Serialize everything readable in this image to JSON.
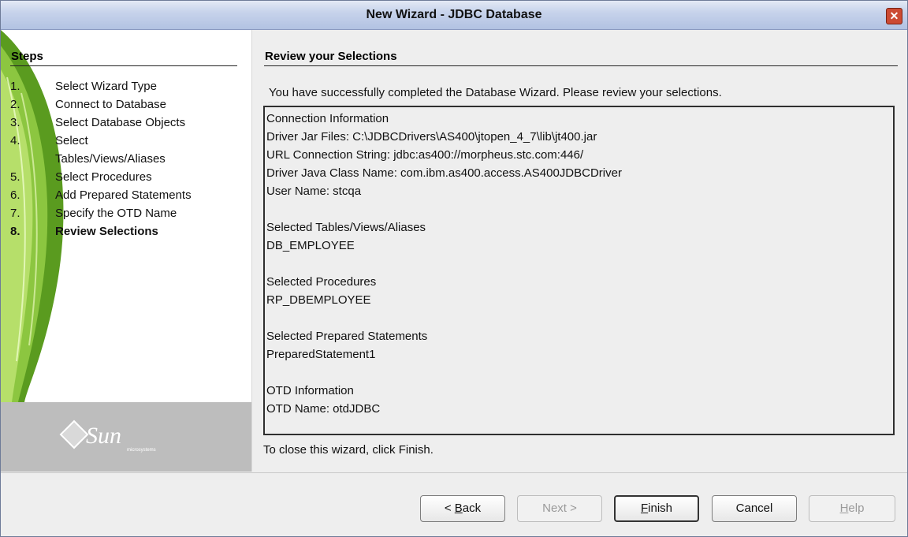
{
  "window": {
    "title": "New Wizard - JDBC Database"
  },
  "steps": {
    "heading": "Steps",
    "items": [
      {
        "num": "1.",
        "label": "Select Wizard Type"
      },
      {
        "num": "2.",
        "label": "Connect to Database"
      },
      {
        "num": "3.",
        "label": "Select Database Objects"
      },
      {
        "num": "4.",
        "label": "Select",
        "label2": "Tables/Views/Aliases"
      },
      {
        "num": "5.",
        "label": "Select Procedures"
      },
      {
        "num": "6.",
        "label": "Add Prepared Statements"
      },
      {
        "num": "7.",
        "label": "Specify the OTD Name"
      },
      {
        "num": "8.",
        "label": "Review Selections",
        "active": true
      }
    ]
  },
  "logo": {
    "text": "Sun",
    "subtext": "microsystems"
  },
  "main": {
    "heading": "Review your Selections",
    "intro": "You have successfully completed the Database Wizard.  Please review your selections.",
    "review_lines": [
      "Connection Information",
      "Driver Jar Files: C:\\JDBCDrivers\\AS400\\jtopen_4_7\\lib\\jt400.jar",
      "URL Connection String: jdbc:as400://morpheus.stc.com:446/",
      "Driver Java Class Name: com.ibm.as400.access.AS400JDBCDriver",
      "User Name: stcqa",
      "",
      "Selected Tables/Views/Aliases",
      "DB_EMPLOYEE",
      "",
      "Selected Procedures",
      "RP_DBEMPLOYEE",
      "",
      "Selected Prepared Statements",
      "PreparedStatement1",
      "",
      "OTD Information",
      "OTD Name: otdJDBC"
    ],
    "closing": "To close this wizard, click Finish."
  },
  "buttons": {
    "back": {
      "prefix": "< ",
      "mnemonic": "B",
      "rest": "ack"
    },
    "next": "Next >",
    "finish": {
      "mnemonic": "F",
      "rest": "inish"
    },
    "cancel": "Cancel",
    "help": {
      "mnemonic": "H",
      "rest": "elp"
    }
  }
}
